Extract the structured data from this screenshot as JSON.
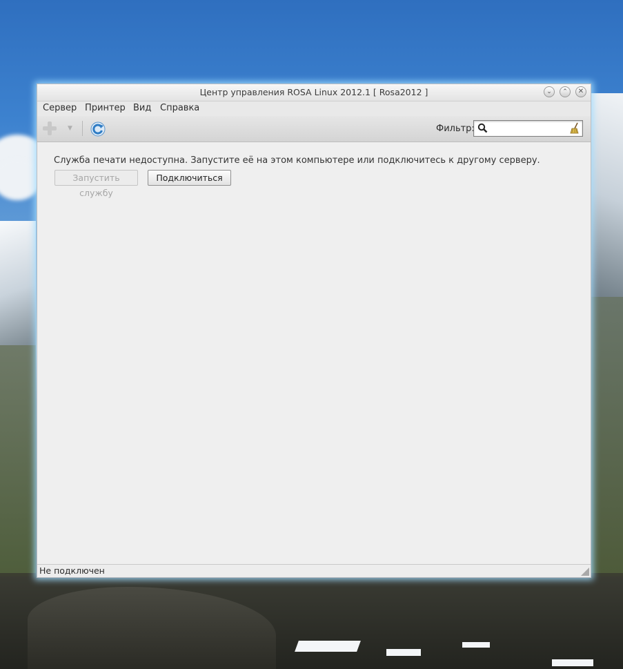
{
  "window": {
    "title": "Центр управления ROSA Linux 2012.1 [ Rosa2012 ]",
    "controls": [
      "minimize-icon",
      "maximize-icon",
      "close-icon"
    ]
  },
  "menu": {
    "items": [
      {
        "label": "Сервер"
      },
      {
        "label": "Принтер"
      },
      {
        "label": "Вид"
      },
      {
        "label": "Справка"
      }
    ]
  },
  "toolbar": {
    "add_icon": "add-printer-icon",
    "dropdown_icon": "dropdown-arrow-icon",
    "refresh_icon": "refresh-icon",
    "filter_label": "Фильтр:",
    "filter_value": "",
    "filter_placeholder": ""
  },
  "main": {
    "message": "Служба печати недоступна. Запустите её на этом компьютере или подключитесь к другому серверу.",
    "start_button": "Запустить службу",
    "connect_button": "Подключиться"
  },
  "status": {
    "text": "Не подключен"
  },
  "colors": {
    "window_bg": "#efefef",
    "glow": "#a0dcff",
    "refresh_blue": "#3c86c8"
  }
}
